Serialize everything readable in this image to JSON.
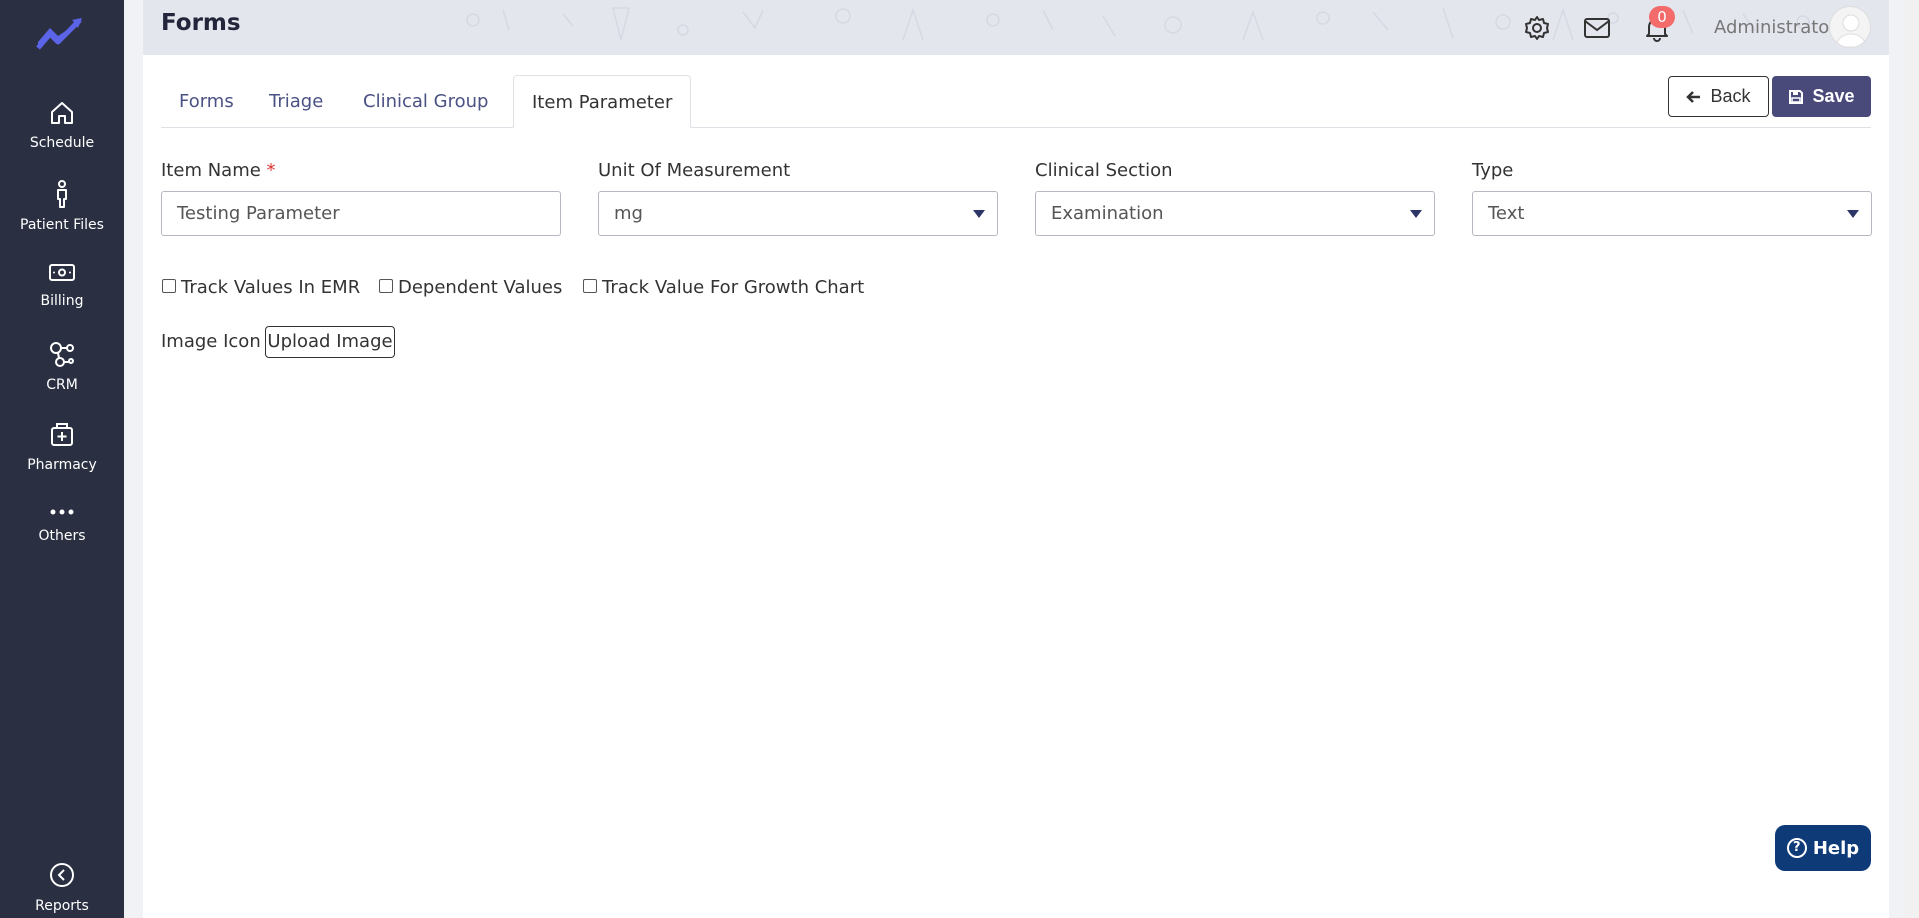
{
  "sidebar": {
    "items": [
      {
        "label": "Schedule",
        "icon": "home-icon"
      },
      {
        "label": "Patient Files",
        "icon": "person-icon"
      },
      {
        "label": "Billing",
        "icon": "money-icon"
      },
      {
        "label": "CRM",
        "icon": "network-icon"
      },
      {
        "label": "Pharmacy",
        "icon": "pharmacy-icon"
      },
      {
        "label": "Others",
        "icon": "dots-icon"
      }
    ],
    "bottom": {
      "label": "Reports",
      "icon": "chevron-left-circle-icon"
    }
  },
  "header": {
    "title": "Forms",
    "notification_count": "0",
    "user": "Administrator"
  },
  "tabs": [
    "Forms",
    "Triage",
    "Clinical Group",
    "Item Parameter"
  ],
  "active_tab": "Item Parameter",
  "actions": {
    "back": "Back",
    "save": "Save"
  },
  "form": {
    "item_name": {
      "label": "Item Name",
      "required_mark": "*",
      "value": "Testing Parameter"
    },
    "unit": {
      "label": "Unit Of Measurement",
      "value": "mg"
    },
    "clinical_section": {
      "label": "Clinical Section",
      "value": "Examination"
    },
    "type": {
      "label": "Type",
      "value": "Text"
    },
    "checkboxes": [
      {
        "label": "Track Values In EMR",
        "checked": false
      },
      {
        "label": "Dependent Values",
        "checked": false
      },
      {
        "label": "Track Value For Growth Chart",
        "checked": false
      }
    ],
    "image_icon": {
      "label": "Image Icon",
      "button": "Upload Image"
    }
  },
  "help": {
    "label": "Help"
  },
  "colors": {
    "sidebar": "#2a3042",
    "accent": "#4a4a7a",
    "help": "#0e3a78",
    "badge": "#f36b6b"
  }
}
